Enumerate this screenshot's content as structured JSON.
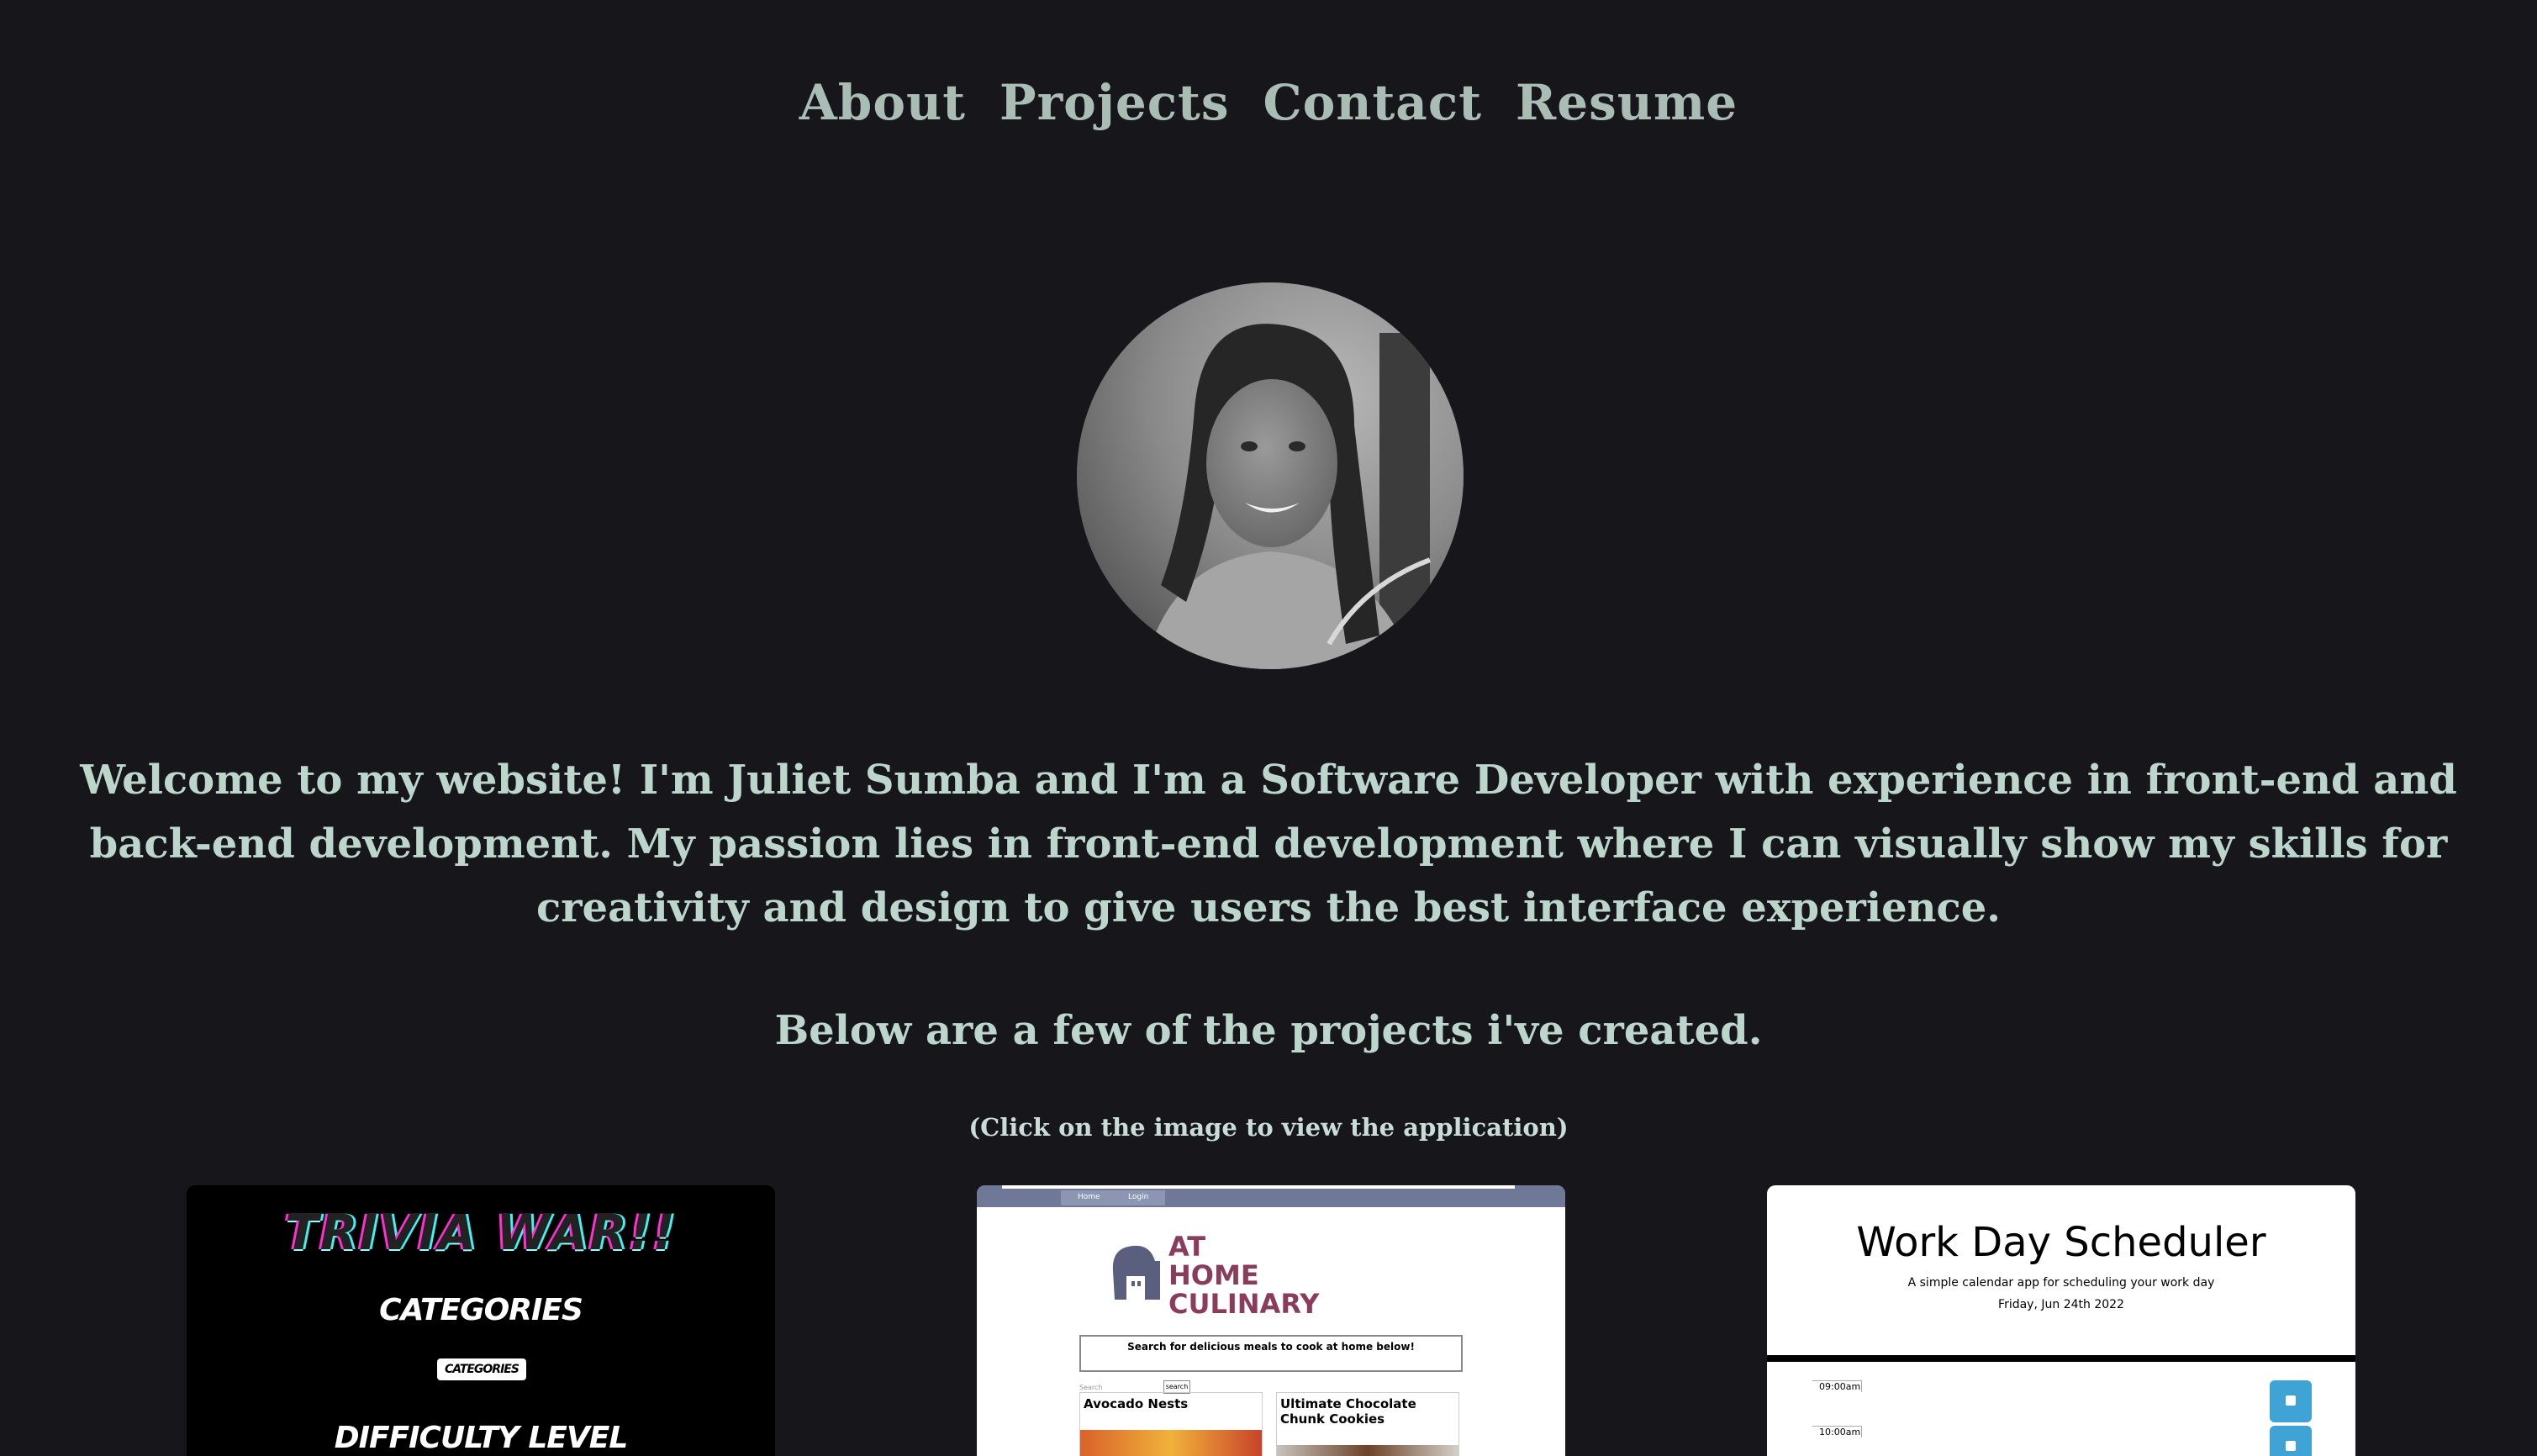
{
  "nav": {
    "items": [
      {
        "label": "About"
      },
      {
        "label": "Projects"
      },
      {
        "label": "Contact"
      },
      {
        "label": "Resume"
      }
    ]
  },
  "intro": {
    "text": "Welcome to my website! I'm Juliet Sumba and I'm a Software Developer with experience in front-end and back-end development. My passion lies in front-end development where I can visually show my skills for creativity and design to give users the best interface experience."
  },
  "projects": {
    "heading": "Below are a few of the projects i've created.",
    "hint": "(Click on the image to view the application)",
    "trivia": {
      "title": "TRIVIA WAR!!",
      "categories_heading": "CATEGORIES",
      "categories_button": "CATEGORIES",
      "difficulty_heading": "DIFFICULTY LEVEL"
    },
    "culinary": {
      "nav_home": "Home",
      "nav_login": "Login",
      "logo_line1": "AT",
      "logo_line2": "HOME",
      "logo_line3": "CULINARY",
      "search_prompt": "Search for delicious meals to cook at home below!",
      "search_placeholder": "Search",
      "search_button": "search",
      "recipe1": "Avocado Nests",
      "recipe2": "Ultimate Chocolate Chunk Cookies"
    },
    "scheduler": {
      "title": "Work Day Scheduler",
      "subtitle": "A simple calendar app for scheduling your work day",
      "date": "Friday, Jun 24th 2022",
      "hour1": "09:00am",
      "hour2": "10:00am"
    }
  },
  "colors": {
    "background": "#17171b",
    "nav_text": "#a9bdb5",
    "body_text": "#bcd6cc",
    "save_button": "#3fa3d6"
  }
}
